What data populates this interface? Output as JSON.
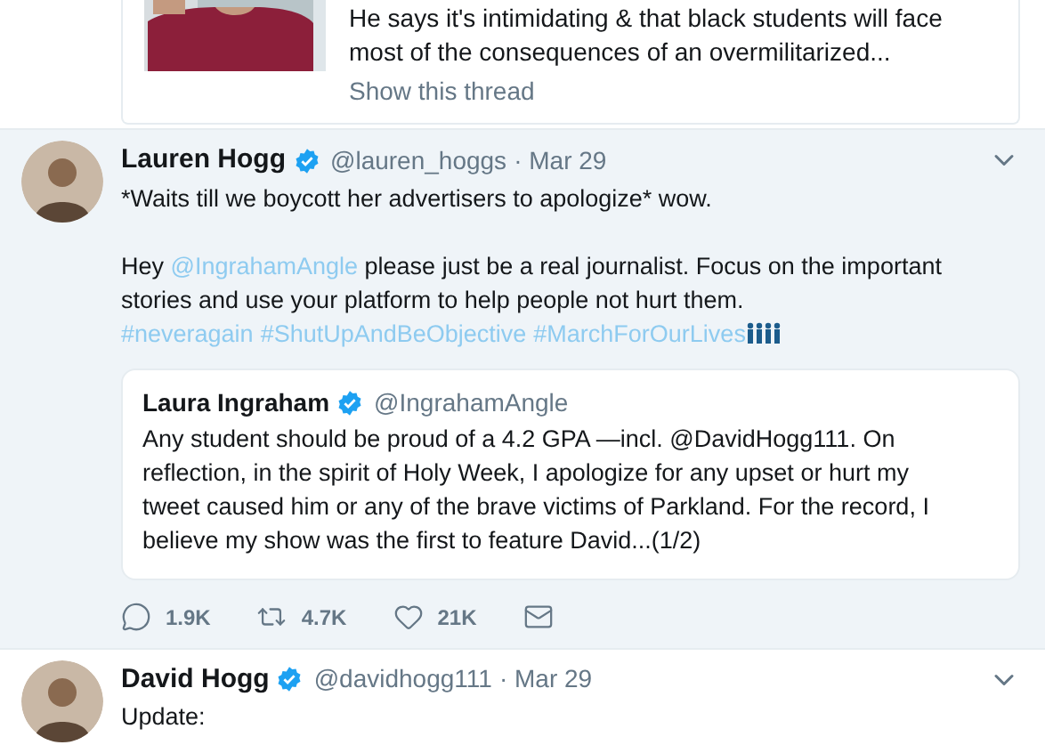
{
  "thread_card": {
    "text": "He says it's intimidating & that black students will face most of the consequences of an overmilitarized...",
    "show_thread": "Show this thread"
  },
  "tweets": [
    {
      "highlighted": true,
      "name": "Lauren Hogg",
      "verified": true,
      "handle": "@lauren_hoggs",
      "date": "· Mar 29",
      "paragraphs": [
        [
          {
            "kind": "text",
            "text": "*Waits till we boycott her advertisers to apologize* wow."
          }
        ],
        [
          {
            "kind": "text",
            "text": "Hey "
          },
          {
            "kind": "mention",
            "text": "@IngrahamAngle"
          },
          {
            "kind": "text",
            "text": " please just be a real journalist. Focus on the important stories and use your platform to help people not hurt them."
          }
        ]
      ],
      "hashtags": [
        "#neveragain",
        "#ShutUpAndBeObjective",
        "#MarchForOurLives"
      ],
      "quote": {
        "name": "Laura Ingraham",
        "verified": true,
        "handle": "@IngrahamAngle",
        "text": "Any student should be proud of a 4.2 GPA —incl. @DavidHogg111.  On reflection, in the spirit of Holy Week, I apologize for any upset or hurt my tweet caused him or any of the brave victims of Parkland. For the record, I believe my show was the first to feature David...(1/2)"
      },
      "actions": [
        {
          "kind": "reply",
          "count": "1.9K"
        },
        {
          "kind": "retweet",
          "count": "4.7K"
        },
        {
          "kind": "like",
          "count": "21K"
        },
        {
          "kind": "message"
        }
      ]
    },
    {
      "highlighted": false,
      "name": "David Hogg",
      "verified": true,
      "handle": "@davidhogg111",
      "date": "· Mar 29",
      "paragraphs": [
        [
          {
            "kind": "text",
            "text": "Update:"
          }
        ]
      ]
    }
  ]
}
